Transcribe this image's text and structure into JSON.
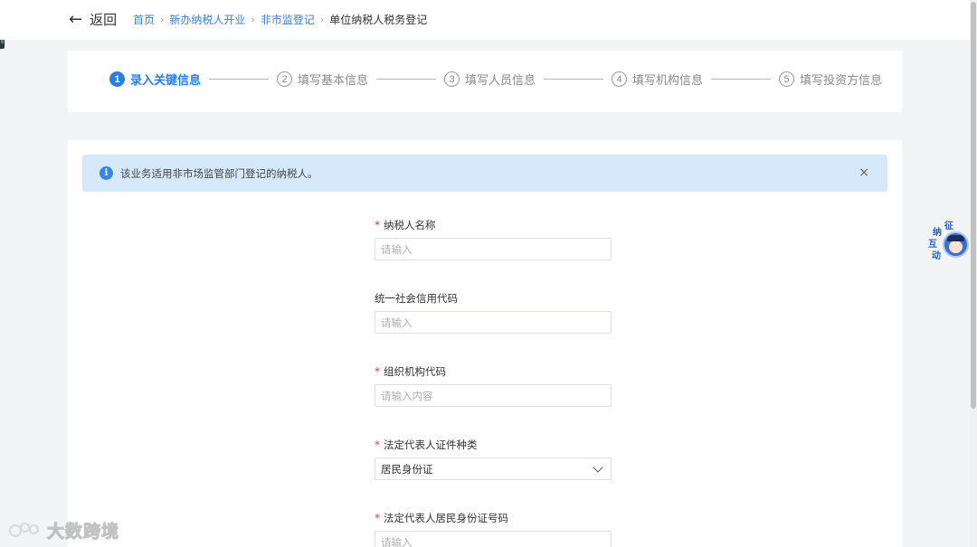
{
  "header": {
    "back_label": "返回",
    "breadcrumbs": [
      "首页",
      "新办纳税人开业",
      "非市监登记"
    ],
    "breadcrumb_current": "单位纳税人税务登记"
  },
  "steps": [
    {
      "num": "1",
      "label": "录入关键信息",
      "active": true
    },
    {
      "num": "2",
      "label": "填写基本信息",
      "active": false
    },
    {
      "num": "3",
      "label": "填写人员信息",
      "active": false
    },
    {
      "num": "4",
      "label": "填写机构信息",
      "active": false
    },
    {
      "num": "5",
      "label": "填写投资方信息",
      "active": false
    }
  ],
  "notice": {
    "text": "该业务适用非市场监管部门登记的纳税人。",
    "close": "×"
  },
  "form": {
    "taxpayer_name": {
      "label": "纳税人名称",
      "required": true,
      "value": "",
      "placeholder": "请输入"
    },
    "credit_code": {
      "label": "统一社会信用代码",
      "required": false,
      "value": "",
      "placeholder": "请输入"
    },
    "org_code": {
      "label": "组织机构代码",
      "required": true,
      "value": "",
      "placeholder": "请输入内容"
    },
    "legal_id_type": {
      "label": "法定代表人证件种类",
      "required": true,
      "value": "居民身份证"
    },
    "legal_id_number": {
      "label": "法定代表人居民身份证号码",
      "required": true,
      "value": "",
      "placeholder": "请输入"
    }
  },
  "assistant": {
    "chars": [
      "征",
      "纳",
      "互",
      "动"
    ]
  },
  "watermark": {
    "text": "大数跨境"
  },
  "colors": {
    "accent": "#2b7de9",
    "notice_bg": "#d6e9fb",
    "required": "#e23b3b"
  }
}
